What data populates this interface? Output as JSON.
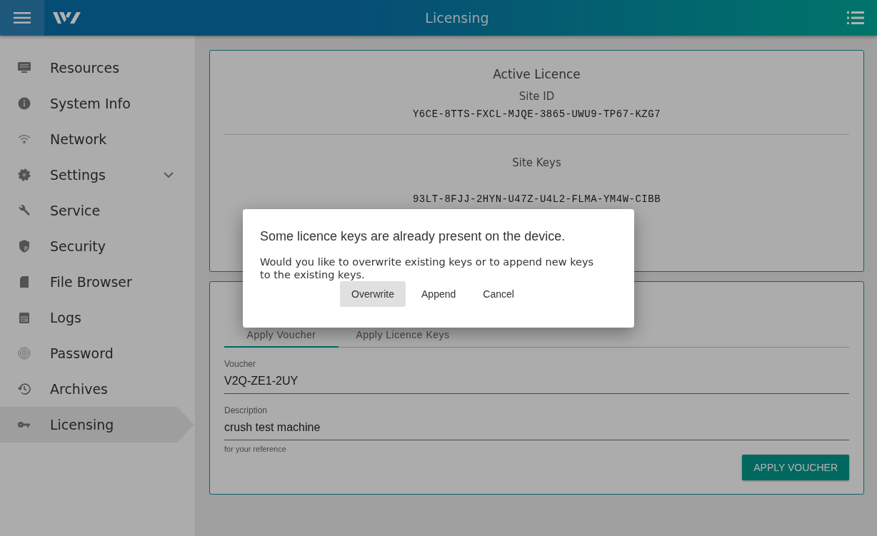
{
  "header": {
    "title": "Licensing"
  },
  "sidebar": {
    "items": [
      {
        "label": "Resources",
        "selected": false,
        "has_submenu": false
      },
      {
        "label": "System Info",
        "selected": false,
        "has_submenu": false
      },
      {
        "label": "Network",
        "selected": false,
        "has_submenu": false
      },
      {
        "label": "Settings",
        "selected": false,
        "has_submenu": true
      },
      {
        "label": "Service",
        "selected": false,
        "has_submenu": false
      },
      {
        "label": "Security",
        "selected": false,
        "has_submenu": false
      },
      {
        "label": "File Browser",
        "selected": false,
        "has_submenu": false
      },
      {
        "label": "Logs",
        "selected": false,
        "has_submenu": false
      },
      {
        "label": "Password",
        "selected": false,
        "has_submenu": false
      },
      {
        "label": "Archives",
        "selected": false,
        "has_submenu": false
      },
      {
        "label": "Licensing",
        "selected": true,
        "has_submenu": false
      }
    ]
  },
  "licence_card": {
    "title": "Active Licence",
    "site_id_label": "Site ID",
    "site_id": "Y6CE-8TTS-FXCL-MJQE-3865-UWU9-TP67-KZG7",
    "site_keys_label": "Site Keys",
    "site_keys": [
      "93LT-8FJJ-2HYN-U47Z-U4L2-FLMA-YM4W-CIBB"
    ]
  },
  "apply_card": {
    "tabs": [
      {
        "label": "Apply Voucher",
        "selected": true
      },
      {
        "label": "Apply Licence Keys",
        "selected": false
      }
    ],
    "fields": [
      {
        "label": "Voucher",
        "value": "V2Q-ZE1-2UY"
      },
      {
        "label": "Description",
        "value": "crush test machine",
        "hint": "for your reference"
      }
    ],
    "button": "APPLY VOUCHER"
  },
  "dialog": {
    "message": "Some licence keys are already present on the device.",
    "question": "Would you like to overwrite existing keys or to append new keys to the existing keys.",
    "buttons": [
      {
        "label": "Overwrite",
        "focused": true
      },
      {
        "label": "Append",
        "focused": false
      },
      {
        "label": "Cancel",
        "focused": false
      }
    ]
  }
}
